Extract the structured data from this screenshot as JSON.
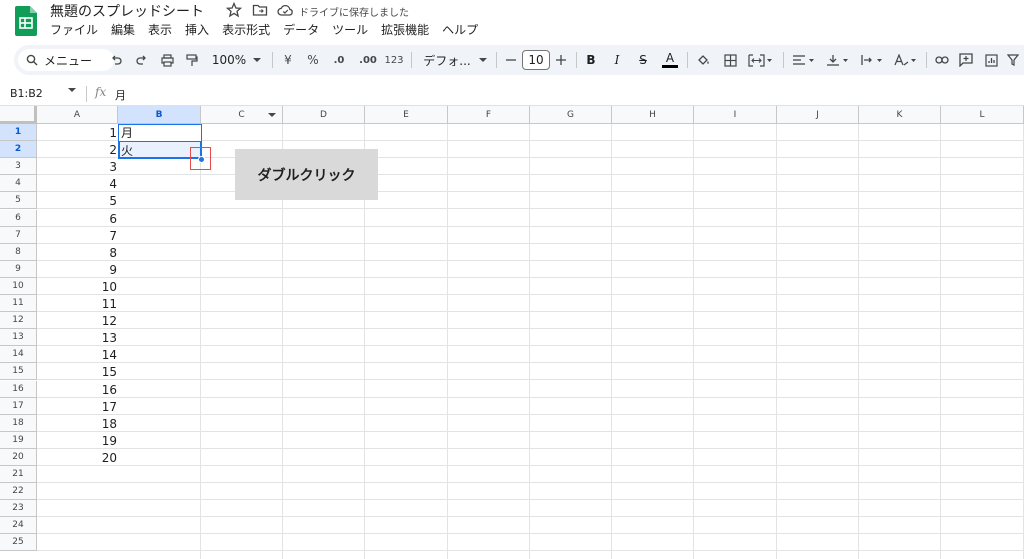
{
  "doc": {
    "title": "無題のスプレッドシート",
    "save_status": "ドライブに保存しました"
  },
  "menu": [
    "ファイル",
    "編集",
    "表示",
    "挿入",
    "表示形式",
    "データ",
    "ツール",
    "拡張機能",
    "ヘルプ"
  ],
  "toolbar": {
    "menu_search": "メニュー",
    "zoom": "100%",
    "currency": "¥",
    "percent": "%",
    "decrease_decimal": ".0",
    "increase_decimal": ".00",
    "number_format": "123",
    "font": "デフォ...",
    "font_size": "10",
    "bold": "B",
    "italic": "I",
    "strike": "S",
    "text_color": "A"
  },
  "formula_bar": {
    "name_box": "B1:B2",
    "fx": "fx",
    "value": "月"
  },
  "grid": {
    "columns": [
      "A",
      "B",
      "C",
      "D",
      "E",
      "F",
      "G",
      "H",
      "I",
      "J",
      "K",
      "L"
    ],
    "rows": [
      "1",
      "2",
      "3",
      "4",
      "5",
      "6",
      "7",
      "8",
      "9",
      "10",
      "11",
      "12",
      "13",
      "14",
      "15",
      "16",
      "17",
      "18",
      "19",
      "20",
      "21",
      "22",
      "23",
      "24",
      "25"
    ],
    "col_a_values": [
      "1",
      "2",
      "3",
      "4",
      "5",
      "6",
      "7",
      "8",
      "9",
      "10",
      "11",
      "12",
      "13",
      "14",
      "15",
      "16",
      "17",
      "18",
      "19",
      "20"
    ],
    "col_b_values": [
      "月",
      "火"
    ]
  },
  "callout": {
    "text": "ダブルクリック"
  },
  "colors": {
    "accent": "#1a73e8",
    "header_selected": "#d3e3fd",
    "highlight_box": "#e8494b",
    "callout_bg": "#d9d9d9",
    "logo_green": "#0f9d58"
  }
}
